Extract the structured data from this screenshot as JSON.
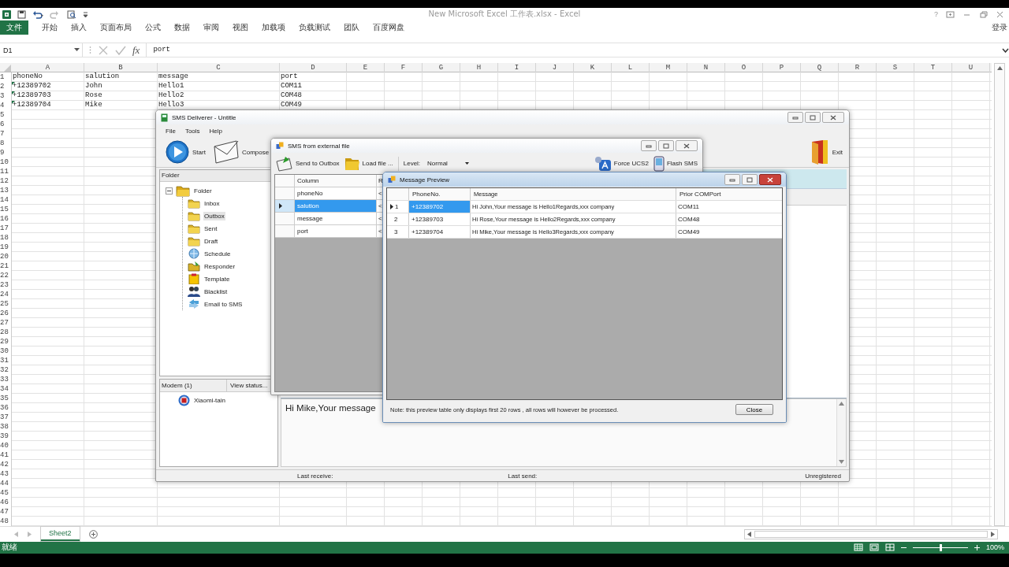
{
  "excel": {
    "title": "New Microsoft Excel 工作表.xlsx - Excel",
    "help": "?",
    "file_tab": "文件",
    "ribbon_tabs": [
      "开始",
      "插入",
      "页面布局",
      "公式",
      "数据",
      "审阅",
      "视图",
      "加载项",
      "负载测试",
      "团队",
      "百度网盘"
    ],
    "sign_in": "登录",
    "name_box": "D1",
    "function_label": "fx",
    "formula": "port",
    "column_headers": [
      "A",
      "B",
      "C",
      "D",
      "E",
      "F",
      "G",
      "H",
      "I",
      "J",
      "K",
      "L",
      "M",
      "N",
      "O",
      "P",
      "Q",
      "R",
      "S",
      "T",
      "U"
    ],
    "rows": [
      {
        "header": "1",
        "cells": [
          "phoneNo",
          "salution",
          "message",
          "port"
        ],
        "warning": false
      },
      {
        "header": "2",
        "cells": [
          "+12389702",
          "John",
          "Hello1",
          "COM11"
        ],
        "warning": true
      },
      {
        "header": "3",
        "cells": [
          "+12389703",
          "Rose",
          "Hello2",
          "COM48"
        ],
        "warning": true
      },
      {
        "header": "4",
        "cells": [
          "+12389704",
          "Mike",
          "Hello3",
          "COM49"
        ],
        "warning": true
      },
      {
        "header": "5"
      },
      {
        "header": "6"
      },
      {
        "header": "7"
      },
      {
        "header": "8"
      },
      {
        "header": "9"
      },
      {
        "header": "10"
      },
      {
        "header": "11"
      },
      {
        "header": "12"
      },
      {
        "header": "13"
      },
      {
        "header": "14"
      },
      {
        "header": "15"
      },
      {
        "header": "16"
      },
      {
        "header": "17"
      },
      {
        "header": "18"
      },
      {
        "header": "19"
      },
      {
        "header": "20"
      },
      {
        "header": "21"
      },
      {
        "header": "22"
      },
      {
        "header": "23"
      },
      {
        "header": "24"
      },
      {
        "header": "25"
      },
      {
        "header": "26"
      },
      {
        "header": "27"
      },
      {
        "header": "28"
      },
      {
        "header": "29"
      },
      {
        "header": "30"
      },
      {
        "header": "31"
      },
      {
        "header": "32"
      },
      {
        "header": "33"
      },
      {
        "header": "34"
      },
      {
        "header": "35"
      },
      {
        "header": "36"
      },
      {
        "header": "37"
      },
      {
        "header": "38"
      },
      {
        "header": "39"
      },
      {
        "header": "40"
      },
      {
        "header": "41"
      },
      {
        "header": "42"
      },
      {
        "header": "43"
      },
      {
        "header": "44"
      },
      {
        "header": "45"
      },
      {
        "header": "46"
      },
      {
        "header": "47"
      },
      {
        "header": "48"
      }
    ],
    "sheet_tabs": [
      {
        "label": "Sheet2",
        "selected": true
      }
    ],
    "status": "就绪",
    "zoom_slider": {
      "level": 0.5
    },
    "zoom": "100%"
  },
  "sms_deliverer": {
    "title": "SMS Deliverer - Untitle",
    "menu": [
      "File",
      "Tools",
      "Help"
    ],
    "toolbar": [
      {
        "label": "Start",
        "kind": "start"
      },
      {
        "label": "Compose",
        "kind": "compose"
      }
    ],
    "exit": "Exit",
    "folder_header": "Folder",
    "tree": {
      "label": "Folder",
      "expanded": true,
      "children": [
        {
          "label": "Inbox",
          "kind": "folder",
          "selected": false
        },
        {
          "label": "Outbox",
          "kind": "folder",
          "selected": true
        },
        {
          "label": "Sent",
          "kind": "folder",
          "selected": false
        },
        {
          "label": "Draft",
          "kind": "folder",
          "selected": false
        },
        {
          "label": "Schedule",
          "kind": "schedule",
          "selected": false
        },
        {
          "label": "Responder",
          "kind": "responder",
          "selected": false
        },
        {
          "label": "Template",
          "kind": "template",
          "selected": false
        },
        {
          "label": "Blacklist",
          "kind": "blacklist",
          "selected": false
        },
        {
          "label": "Email to SMS",
          "kind": "email",
          "selected": false
        }
      ]
    },
    "modem_header": "Modem (1)",
    "view_status": "View status...",
    "modems": [
      "Xiaomi-tain"
    ],
    "message_text": "Hi Mike,Your message",
    "status": [
      "Last receive:",
      "Last send:",
      "Unregistered"
    ]
  },
  "external_file": {
    "title": "SMS from external file",
    "toolbar_left": [
      {
        "label": "Send to Outbox",
        "kind": "send"
      },
      {
        "label": "Load file ...",
        "kind": "load"
      }
    ],
    "level_label": "Level:",
    "level_value": "Normal",
    "toolbar_right": [
      {
        "label": "Force UCS2",
        "kind": "ucs2"
      },
      {
        "label": "Flash SMS",
        "kind": "flash"
      }
    ],
    "columns": [
      "Column",
      "R"
    ],
    "rows": [
      {
        "column": "phoneNo",
        "column_2": "<",
        "selected": false
      },
      {
        "column": "salution",
        "column_2": "<",
        "selected": true
      },
      {
        "column": "message",
        "column_2": "<",
        "selected": false
      },
      {
        "column": "port",
        "column_2": "<",
        "selected": false
      }
    ]
  },
  "message_preview": {
    "title": "Message Preview",
    "columns": [
      "PhoneNo.",
      "Message",
      "Prior COMPort"
    ],
    "rows": [
      {
        "index": "1",
        "current": true,
        "selected": true,
        "phone": "+12389702",
        "message": "Hi John,Your message is Hello1Regards,xxx company",
        "port": "COM11"
      },
      {
        "index": "2",
        "current": false,
        "selected": false,
        "phone": "+12389703",
        "message": "Hi Rose,Your message is Hello2Regards,xxx company",
        "port": "COM48"
      },
      {
        "index": "3",
        "current": false,
        "selected": false,
        "phone": "+12389704",
        "message": "Hi Mike,Your message is Hello3Regards,xxx company",
        "port": "COM49"
      }
    ],
    "note": "Note: this preview table only displays first 20 rows , all rows will however be processed.",
    "close": "Close"
  }
}
